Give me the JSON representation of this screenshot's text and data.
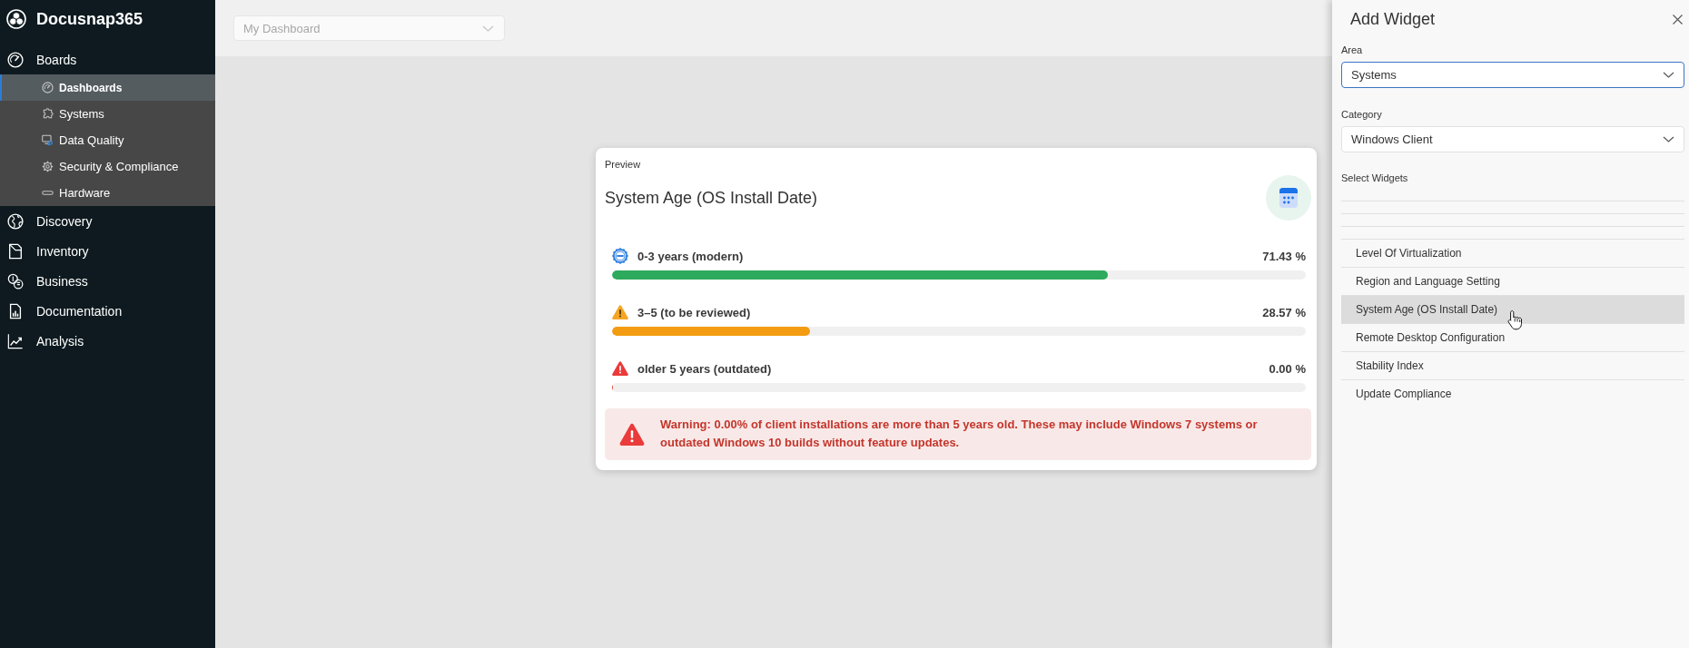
{
  "app": {
    "name": "Docusnap365"
  },
  "sidebar": {
    "items": [
      {
        "label": "Boards",
        "selected": false,
        "children": [
          {
            "label": "Dashboards",
            "selected": true
          },
          {
            "label": "Systems",
            "selected": false
          },
          {
            "label": "Data Quality",
            "selected": false
          },
          {
            "label": "Security & Compliance",
            "selected": false
          },
          {
            "label": "Hardware",
            "selected": false
          }
        ]
      },
      {
        "label": "Discovery",
        "selected": false
      },
      {
        "label": "Inventory",
        "selected": false
      },
      {
        "label": "Business",
        "selected": false
      },
      {
        "label": "Documentation",
        "selected": false
      },
      {
        "label": "Analysis",
        "selected": false
      }
    ]
  },
  "toolbar": {
    "dashboard_select": {
      "placeholder": "My Dashboard"
    }
  },
  "preview": {
    "label": "Preview",
    "title": "System Age (OS Install Date)",
    "rows": [
      {
        "kind": "modern",
        "label": "0-3 years (modern)",
        "value": "71.43 %",
        "level": 0.7143
      },
      {
        "kind": "review",
        "label": "3–5 (to be reviewed)",
        "value": "28.57 %",
        "level": 0.2857
      },
      {
        "kind": "outdated",
        "label": "older 5 years (outdated)",
        "value": "0.00 %",
        "level": 0
      }
    ],
    "warning": "Warning: 0.00% of client installations are more than 5 years old. These may include Windows 7 systems or outdated Windows 10 builds without feature updates."
  },
  "panel": {
    "title": "Add Widget",
    "fields": [
      {
        "label": "Area",
        "value": "Systems",
        "focused": true
      },
      {
        "label": "Category",
        "value": "Windows Client",
        "focused": false
      }
    ],
    "widgets_label": "Select Widgets",
    "widgets": [
      {
        "label": "Level Of Virtualization",
        "selected": false
      },
      {
        "label": "Region and Language Setting",
        "selected": false
      },
      {
        "label": "System Age (OS Install Date)",
        "selected": true
      },
      {
        "label": "Remote Desktop Configuration",
        "selected": false
      },
      {
        "label": "Stability Index",
        "selected": false
      },
      {
        "label": "Update Compliance",
        "selected": false
      }
    ]
  }
}
